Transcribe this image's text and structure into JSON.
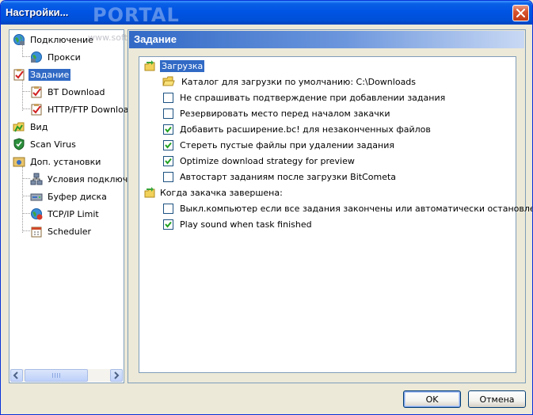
{
  "window": {
    "title": "Настройки...",
    "watermark": "PORTAL",
    "watermark_sub": "www.softportal.com"
  },
  "sidebar": {
    "items": [
      {
        "label": "Подключение",
        "icon": "globe-network-icon",
        "level": 0
      },
      {
        "label": "Прокси",
        "icon": "globe-proxy-icon",
        "level": 1
      },
      {
        "label": "Задание",
        "icon": "task-clipboard-icon",
        "level": 0,
        "selected": true
      },
      {
        "label": "BT Download",
        "icon": "bt-download-icon",
        "level": 1
      },
      {
        "label": "HTTP/FTP Downloa",
        "icon": "http-ftp-download-icon",
        "level": 1
      },
      {
        "label": "Вид",
        "icon": "view-folder-icon",
        "level": 0
      },
      {
        "label": "Scan Virus",
        "icon": "shield-icon",
        "level": 0
      },
      {
        "label": "Доп. установки",
        "icon": "advanced-settings-icon",
        "level": 0
      },
      {
        "label": "Условия подключ",
        "icon": "network-conditions-icon",
        "level": 1
      },
      {
        "label": "Буфер диска",
        "icon": "disk-buffer-icon",
        "level": 1
      },
      {
        "label": "TCP/IP Limit",
        "icon": "tcpip-limit-icon",
        "level": 1
      },
      {
        "label": "Scheduler",
        "icon": "scheduler-icon",
        "level": 1
      }
    ]
  },
  "panel": {
    "header": "Задание",
    "groups": [
      {
        "label": "Загрузка",
        "selected": true,
        "items": [
          {
            "type": "folder",
            "label": "Каталог для загрузки по умолчанию: C:\\Downloads"
          },
          {
            "type": "checkbox",
            "label": "Не спрашивать подтверждение при добавлении задания",
            "checked": false
          },
          {
            "type": "checkbox",
            "label": "Резервировать место перед началом закачки",
            "checked": false
          },
          {
            "type": "checkbox",
            "label": "Добавить расширение.bc! для незаконченных файлов",
            "checked": true
          },
          {
            "type": "checkbox",
            "label": "Стереть пустые файлы при удалении задания",
            "checked": true
          },
          {
            "type": "checkbox",
            "label": "Optimize download strategy for preview",
            "checked": true
          },
          {
            "type": "checkbox",
            "label": "Автостарт заданиям после загрузки BitCometa",
            "checked": false
          }
        ]
      },
      {
        "label": "Когда закачка завершена:",
        "selected": false,
        "items": [
          {
            "type": "checkbox",
            "label": "Выкл.компьютер если все задания закончены или автоматически остановлены",
            "checked": false
          },
          {
            "type": "checkbox",
            "label": "Play sound when task finished",
            "checked": true
          }
        ]
      }
    ]
  },
  "buttons": {
    "ok": "OK",
    "cancel": "Отмена"
  },
  "colors": {
    "selection": "#316ac5",
    "titlebar": "#0054e3",
    "check": "#21a121"
  }
}
